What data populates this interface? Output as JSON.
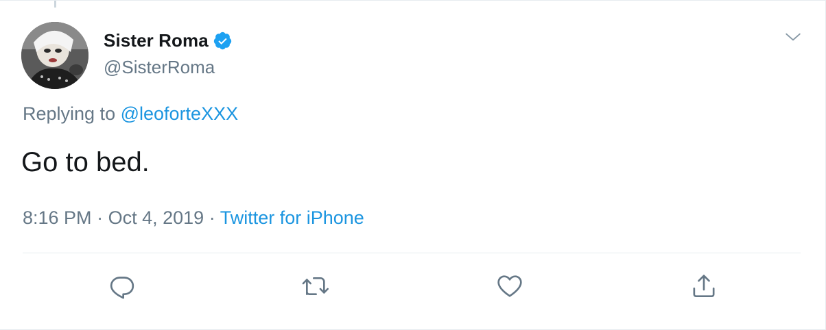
{
  "user": {
    "display_name": "Sister Roma",
    "handle": "@SisterRoma",
    "verified": true
  },
  "reply": {
    "prefix": "Replying to",
    "mention": "@leoforteXXX"
  },
  "tweet": {
    "text": "Go to bed."
  },
  "meta": {
    "time": "8:16 PM",
    "separator": "·",
    "date": "Oct 4, 2019",
    "source": "Twitter for iPhone"
  },
  "actions": {
    "reply_icon": "reply-icon",
    "retweet_icon": "retweet-icon",
    "like_icon": "heart-icon",
    "share_icon": "share-icon"
  },
  "colors": {
    "text": "#14171a",
    "secondary": "#657786",
    "link": "#1b95e0",
    "verified": "#1da1f2",
    "divider": "#e6ecf0"
  }
}
